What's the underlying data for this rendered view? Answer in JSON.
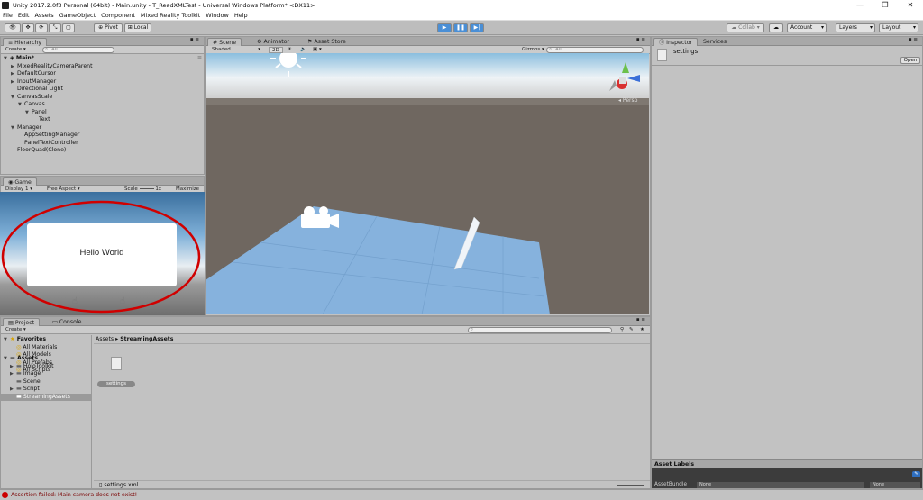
{
  "window": {
    "title": "Unity 2017.2.0f3 Personal (64bit) - Main.unity - T_ReadXMLTest - Universal Windows Platform* <DX11>"
  },
  "menu": [
    "File",
    "Edit",
    "Assets",
    "GameObject",
    "Component",
    "Mixed Reality Toolkit",
    "Window",
    "Help"
  ],
  "toolbar": {
    "pivot": "Pivot",
    "local": "Local",
    "collab": "Collab",
    "account": "Account",
    "layers": "Layers",
    "layout": "Layout"
  },
  "hierarchy": {
    "tab": "Hierarchy",
    "create": "Create",
    "search_placeholder": "All",
    "scene": "Main*",
    "items": [
      {
        "label": "MixedRealityCameraParent",
        "depth": 1,
        "arrow": "right"
      },
      {
        "label": "DefaultCursor",
        "depth": 1,
        "arrow": "right"
      },
      {
        "label": "InputManager",
        "depth": 1,
        "arrow": "right"
      },
      {
        "label": "Directional Light",
        "depth": 1,
        "arrow": ""
      },
      {
        "label": "CanvasScale",
        "depth": 1,
        "arrow": "down"
      },
      {
        "label": "Canvas",
        "depth": 2,
        "arrow": "down"
      },
      {
        "label": "Panel",
        "depth": 3,
        "arrow": "down"
      },
      {
        "label": "Text",
        "depth": 4,
        "arrow": ""
      },
      {
        "label": "Manager",
        "depth": 1,
        "arrow": "down"
      },
      {
        "label": "AppSettingManager",
        "depth": 2,
        "arrow": ""
      },
      {
        "label": "PanelTextController",
        "depth": 2,
        "arrow": ""
      },
      {
        "label": "FloorQuad(Clone)",
        "depth": 1,
        "arrow": ""
      }
    ]
  },
  "scene": {
    "tabs": [
      "Scene",
      "Animator",
      "Asset Store"
    ],
    "shading": "Shaded",
    "mode2d": "2D",
    "gizmos": "Gizmos",
    "search_placeholder": "All",
    "persp": "Persp"
  },
  "game": {
    "tab": "Game",
    "display": "Display 1",
    "aspect": "Free Aspect",
    "scale_label": "Scale",
    "scale_value": "1x",
    "maximize": "Maximize O",
    "panel_text": "Hello World"
  },
  "project": {
    "tabs": [
      "Project",
      "Console"
    ],
    "create": "Create",
    "favorites_label": "Favorites",
    "favorites": [
      "All Materials",
      "All Models",
      "All Prefabs",
      "All Scripts"
    ],
    "assets_label": "Assets",
    "assets": [
      "HoloToolkit",
      "Image",
      "Scene",
      "Script",
      "StreamingAssets"
    ],
    "breadcrumb": [
      "Assets",
      "StreamingAssets"
    ],
    "file_label": "settings",
    "footer_file": "settings.xml"
  },
  "inspector": {
    "tabs": [
      "Inspector",
      "Services"
    ],
    "asset_name": "settings",
    "open_label": "Open",
    "asset_labels": "Asset Labels",
    "asset_bundle": "AssetBundle",
    "bundle_value": "None",
    "variant_value": "None"
  },
  "status": {
    "message": "Assertion failed: Main camera does not exist!"
  }
}
